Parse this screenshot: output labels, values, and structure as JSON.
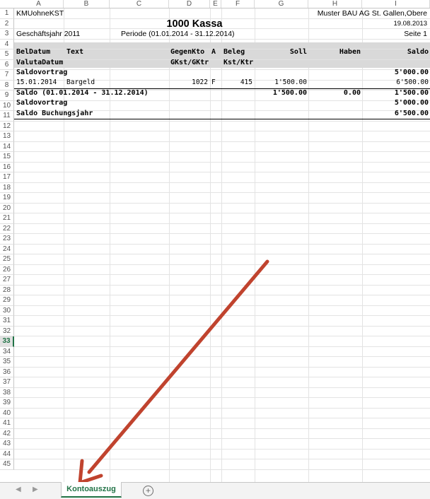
{
  "columns": [
    "A",
    "B",
    "C",
    "D",
    "E",
    "F",
    "G",
    "H",
    "I"
  ],
  "row_numbers": [
    "1",
    "2",
    "3",
    "4",
    "5",
    "6",
    "7",
    "8",
    "9",
    "10",
    "11",
    "12",
    "13",
    "14",
    "15",
    "16",
    "17",
    "18",
    "19",
    "20",
    "21",
    "22",
    "23",
    "24",
    "25",
    "26",
    "27",
    "28",
    "29",
    "30",
    "31",
    "32",
    "33",
    "34",
    "35",
    "36",
    "37",
    "38",
    "39",
    "40",
    "41",
    "42",
    "43",
    "44",
    "45"
  ],
  "selected_row": "33",
  "report": {
    "company_short": "KMUohneKST",
    "company_right": "Muster BAU AG St. Gallen,Obere",
    "title": "1000 Kassa",
    "date": "19.08.2013",
    "year_label": "Geschäftsjahr 2011",
    "period_label": "Periode (01.01.2014 - 31.12.2014)",
    "page_label": "Seite 1"
  },
  "headers": {
    "beldatum": "BelDatum",
    "text": "Text",
    "gegenkto": "GegenKto",
    "a": "A",
    "beleg": "Beleg",
    "soll": "Soll",
    "haben": "Haben",
    "saldo": "Saldo",
    "valutadatum": "ValutaDatum",
    "gkst": "GKst/GKtr",
    "kst": "Kst/Ktr"
  },
  "rows": {
    "saldovortrag_label": "Saldovortrag",
    "saldovortrag_value": "5'000.00",
    "entry_date": "15.01.2014",
    "entry_text": "Bargeld",
    "entry_gegenkto": "1022",
    "entry_a": "F",
    "entry_beleg": "415",
    "entry_soll": "1'500.00",
    "entry_saldo": "6'500.00",
    "saldo_period_label": "Saldo (01.01.2014 - 31.12.2014)",
    "saldo_period_soll": "1'500.00",
    "saldo_period_haben": "0.00",
    "saldo_period_saldo": "1'500.00",
    "saldovortrag2_label": "Saldovortrag",
    "saldovortrag2_value": "5'000.00",
    "saldo_jahr_label": "Saldo Buchungsjahr",
    "saldo_jahr_value": "6'500.00"
  },
  "sheet_tabs": {
    "active_tab": "Kontoauszug",
    "add_symbol": "+"
  },
  "colors": {
    "accent": "#217346",
    "header_fill": "#d9d9d9",
    "arrow": "#c0432e"
  }
}
